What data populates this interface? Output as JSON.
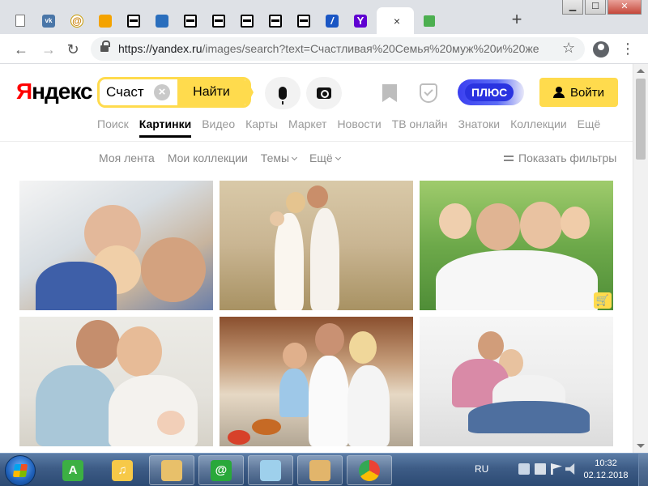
{
  "browser": {
    "tabs": [
      {
        "icon": "doc",
        "label": ""
      },
      {
        "icon": "vk",
        "label": "vk"
      },
      {
        "icon": "mail",
        "label": "@"
      },
      {
        "icon": "okp",
        "label": ""
      },
      {
        "icon": "bar",
        "label": ""
      },
      {
        "icon": "cat",
        "label": ""
      },
      {
        "icon": "bar",
        "label": ""
      },
      {
        "icon": "bar",
        "label": ""
      },
      {
        "icon": "bar",
        "label": ""
      },
      {
        "icon": "bar",
        "label": ""
      },
      {
        "icon": "bar",
        "label": ""
      },
      {
        "icon": "slash",
        "label": "/"
      },
      {
        "icon": "yah",
        "label": "Y"
      },
      {
        "icon": "active",
        "label": ""
      },
      {
        "icon": "green",
        "label": ""
      }
    ],
    "active_tab_close": "×",
    "new_tab": "+",
    "window": {
      "minimize": "▁",
      "maximize": "☐",
      "close": "✕"
    },
    "nav": {
      "back": "←",
      "forward": "→",
      "reload": "↻",
      "star": "☆",
      "menu": "⋮"
    },
    "url_host": "https://yandex.ru",
    "url_path": "/images/search?text=Счастливая%20Семья%20муж%20и%20жен..."
  },
  "yandex": {
    "logo_red": "Я",
    "logo_rest": "ндекс",
    "search_value": "Счаст",
    "search_clear": "×",
    "search_button": "Найти",
    "plus_label": "ПЛЮС",
    "login_label": "Войти",
    "services": [
      {
        "label": "Поиск",
        "active": false
      },
      {
        "label": "Картинки",
        "active": true
      },
      {
        "label": "Видео",
        "active": false
      },
      {
        "label": "Карты",
        "active": false
      },
      {
        "label": "Маркет",
        "active": false
      },
      {
        "label": "Новости",
        "active": false
      },
      {
        "label": "ТВ онлайн",
        "active": false
      },
      {
        "label": "Знатоки",
        "active": false
      },
      {
        "label": "Коллекции",
        "active": false
      },
      {
        "label": "Ещё",
        "active": false
      }
    ],
    "subnav": {
      "feed": "Моя лента",
      "collections": "Мои коллекции",
      "themes": "Темы",
      "more": "Ещё",
      "filters": "Показать фильтры"
    },
    "images": [
      {
        "scene": "family lying together",
        "shop_badge": false
      },
      {
        "scene": "family walking in field",
        "shop_badge": false
      },
      {
        "scene": "parents carrying children",
        "shop_badge": true
      },
      {
        "scene": "parents with newborn",
        "shop_badge": false
      },
      {
        "scene": "family cooking in kitchen",
        "shop_badge": false
      },
      {
        "scene": "couple on white sofa",
        "shop_badge": false
      }
    ],
    "shop_badge_icon": "🛒"
  },
  "taskbar": {
    "apps": [
      {
        "name": "alisa-app",
        "label": "A",
        "color": "#3cb043"
      },
      {
        "name": "music-app",
        "label": "♫",
        "color": "#f7c948"
      },
      {
        "name": "explorer-app",
        "label": "",
        "color": "#e8c06a"
      },
      {
        "name": "mail-agent-app",
        "label": "@",
        "color": "#29a83a"
      },
      {
        "name": "notepad-app",
        "label": "",
        "color": "#9ed0ec"
      },
      {
        "name": "paint-app",
        "label": "",
        "color": "#e2b56b"
      },
      {
        "name": "chrome-app",
        "label": "",
        "color": "#4285f4"
      }
    ],
    "lang": "RU",
    "time": "10:32",
    "date": "02.12.2018"
  }
}
